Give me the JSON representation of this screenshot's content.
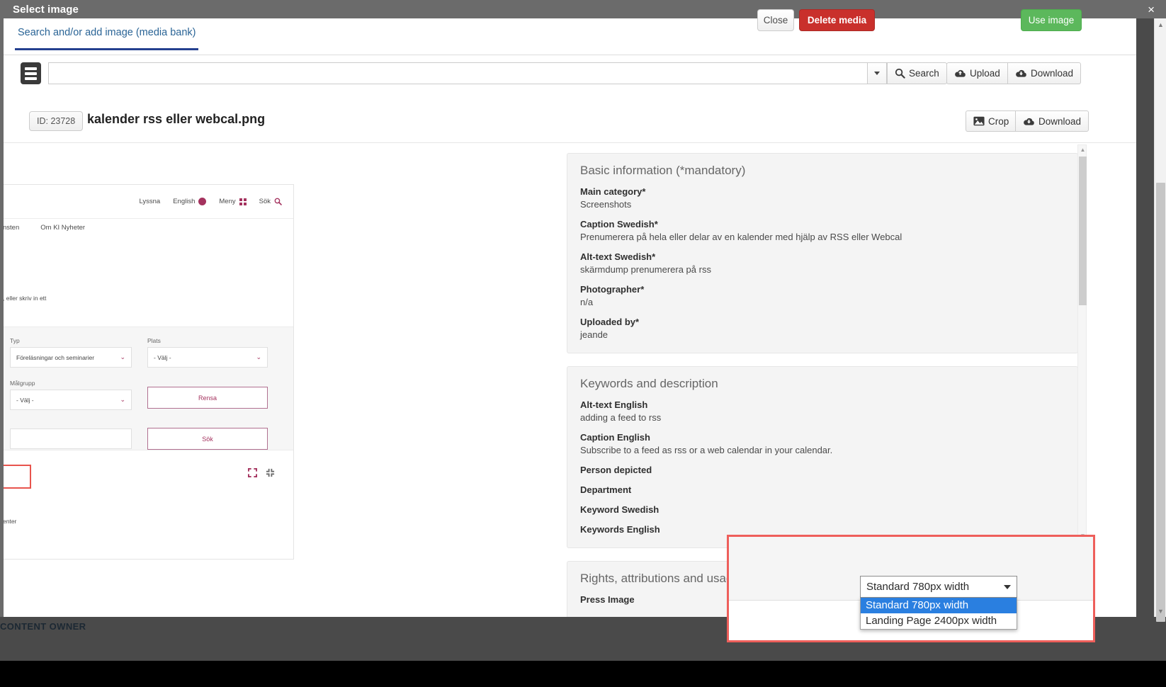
{
  "window": {
    "title": "Select image",
    "close_label": "×"
  },
  "tabs": [
    {
      "label": "Search and/or add image (media bank)",
      "active": true
    }
  ],
  "toolbar": {
    "menu_icon": "hamburger-icon",
    "search_value": "",
    "search_placeholder": "",
    "dropdown_caret": "chevron-down-icon",
    "search_label": "Search",
    "search_icon": "magnifier-icon",
    "upload_label": "Upload",
    "upload_icon": "cloud-upload-icon",
    "download_label": "Download",
    "download_icon": "cloud-download-icon"
  },
  "file": {
    "id_label": "ID: 23728",
    "name": "kalender rss eller webcal.png",
    "crop_label": "Crop",
    "crop_icon": "image-crop-icon",
    "download_label": "Download",
    "download_icon": "cloud-download-icon"
  },
  "preview": {
    "nav_links": [
      "Lyssna",
      "English",
      "Meny",
      "Sök"
    ],
    "breadcrumbs": [
      "nsten",
      "Om KI Nyheter"
    ],
    "subtitle": ", eller skriv in ett",
    "form": {
      "type_label": "Typ",
      "type_value": "Föreläsningar och seminarier",
      "place_label": "Plats",
      "place_value": "- Välj -",
      "audience_label": "Målgrupp",
      "audience_value": "- Välj -",
      "clear_button": "Rensa",
      "search_button": "Sök"
    },
    "footer_text": "enter"
  },
  "info": {
    "sections": [
      {
        "heading": "Basic information (*mandatory)",
        "fields": [
          {
            "label": "Main category*",
            "value": "Screenshots"
          },
          {
            "label": "Caption Swedish*",
            "value": "Prenumerera på hela eller delar av en kalender med hjälp av RSS eller Webcal"
          },
          {
            "label": "Alt-text Swedish*",
            "value": "skärmdump prenumerera på rss"
          },
          {
            "label": "Photographer*",
            "value": "n/a"
          },
          {
            "label": "Uploaded by*",
            "value": "jeande"
          }
        ]
      },
      {
        "heading": "Keywords and description",
        "fields": [
          {
            "label": "Alt-text English",
            "value": "adding a feed to rss"
          },
          {
            "label": "Caption English",
            "value": "Subscribe to a feed as rss or a web calendar in your calendar."
          },
          {
            "label": "Person depicted",
            "value": ""
          },
          {
            "label": "Department",
            "value": ""
          },
          {
            "label": "Keyword Swedish",
            "value": ""
          },
          {
            "label": "Keywords English",
            "value": ""
          }
        ]
      },
      {
        "heading": "Rights, attributions and usage",
        "fields": [
          {
            "label": "Press Image",
            "value": ""
          }
        ]
      }
    ]
  },
  "dialog": {
    "close_label": "Close",
    "delete_label": "Delete media",
    "use_image_label": "Use image",
    "size_selected": "Standard 780px width",
    "size_options": [
      {
        "label": "Standard 780px width",
        "selected": true
      },
      {
        "label": "Landing Page 2400px width",
        "selected": false
      }
    ],
    "outline_color": "#ee5f5b"
  },
  "page_footer": {
    "label": "CONTENT OWNER"
  },
  "colors": {
    "titlebar": "#6b6b6b",
    "tab_underline": "#25408f",
    "danger": "#c9302c",
    "success": "#5cb85c",
    "highlight": "#2a7fe0"
  }
}
